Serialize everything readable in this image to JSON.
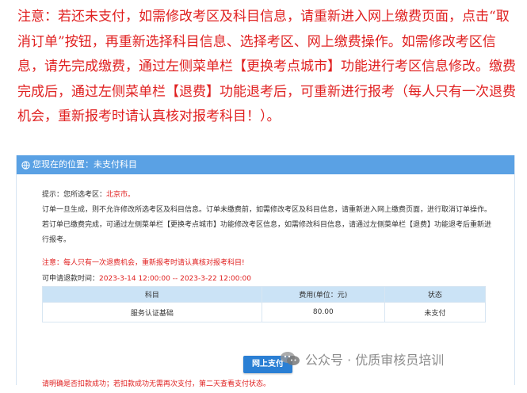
{
  "notice": "注意：若还未支付，如需修改考区及科目信息，请重新进入网上缴费页面，点击“取消订单”按钮，再重新选择科目信息、选择考区、网上缴费操作。如需修改考区信息，请先完成缴费，通过左侧菜单栏【更换考点城市】功能进行考区信息修改。缴费完成后，通过左侧菜单栏【退费】功能退考后，可重新进行报考（每人只有一次退费机会，重新报考时请认真核对报考科目！）。",
  "panel": {
    "location": "您现在的位置：未支付科目",
    "hint_prefix": "提示：您所选考区：",
    "hint_region": "北京市。",
    "description": "订单一旦生成，则不允许修改所选考区及科目信息。订单未缴费前，如需修改考区及科目信息，请重新进入网上缴费页面，进行取消订单操作。若订单已缴费完成，可通过左侧菜单栏【更换考点城市】功能修改考区信息，如需修改科目信息，请通过左侧菜单栏【退费】功能退考后重新进行报考。",
    "warning": "注意：每人只有一次退费机会，重新报考时请认真核对报考科目!",
    "refund_label": "可申请退款时间：",
    "refund_period": "2023-3-14 12:00:00 -- 2023-3-22 12:00:00",
    "table": {
      "headers": [
        "科目",
        "费用(单位：元)",
        "状态"
      ],
      "rows": [
        [
          "服务认证基础",
          "80.00",
          "未支付"
        ]
      ]
    },
    "pay_button": "网上支付",
    "bottom_note": "请明确是否扣款成功；若扣款成功无需再次支付，第二天查看支付状态。"
  },
  "watermark": "公众号 · 优质审核员培训",
  "icons": {
    "location": "location-globe-icon",
    "watermark": "wechat-icon"
  },
  "colors": {
    "accent": "#5aa1e4",
    "warning": "#e02020",
    "button": "#2a7fd4"
  }
}
